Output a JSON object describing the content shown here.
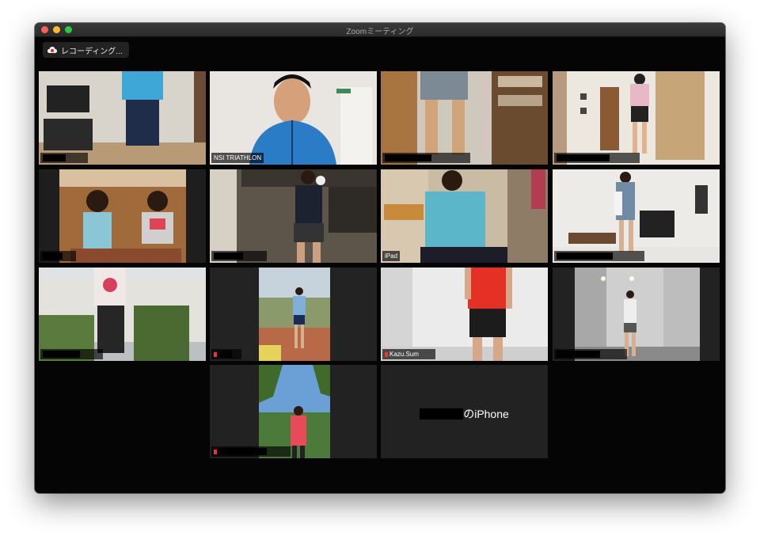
{
  "window": {
    "title": "Zoomミーティング"
  },
  "recording": {
    "label": "レコーディング..."
  },
  "participants": [
    {
      "name": "",
      "redacted": true
    },
    {
      "name": "NSI TRIATHLON",
      "redacted": false,
      "active": true
    },
    {
      "name": "",
      "redacted": true
    },
    {
      "name": "",
      "redacted": true
    },
    {
      "name": "",
      "redacted": true
    },
    {
      "name": "",
      "redacted": true
    },
    {
      "name": "iPad",
      "redacted": false
    },
    {
      "name": "",
      "redacted": true
    },
    {
      "name": "",
      "redacted": true
    },
    {
      "name": "",
      "redacted": true
    },
    {
      "name": "Kazu.Sum",
      "redacted": false
    },
    {
      "name": "",
      "redacted": true
    },
    {
      "name": "",
      "redacted": true
    },
    {
      "name": "のiPhone",
      "redacted": false,
      "video_off": true
    }
  ]
}
